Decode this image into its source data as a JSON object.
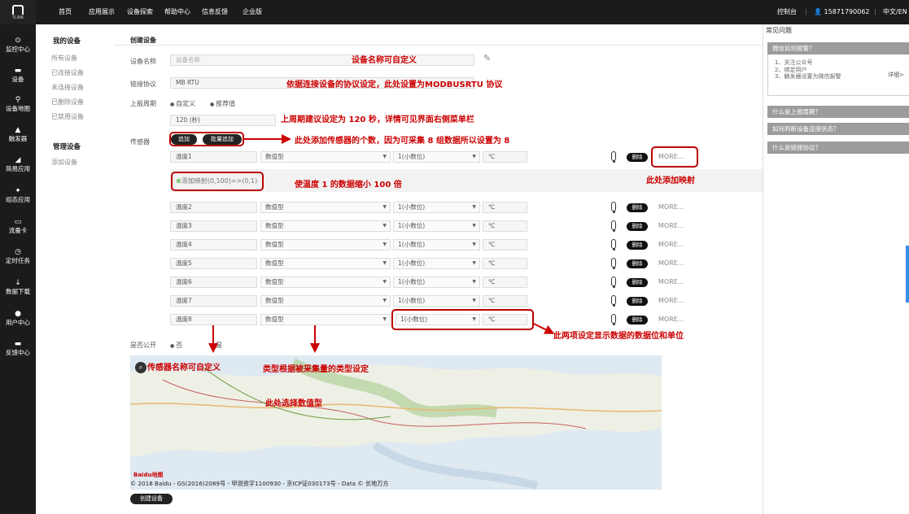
{
  "topbar": {
    "logo_caption": "TLINK",
    "nav": [
      "首页",
      "应用展示",
      "设备探索",
      "帮助中心",
      "信息反馈",
      "企业版"
    ],
    "console": "控制台",
    "user": "15871790062",
    "lang": "中文/EN"
  },
  "sidebar": {
    "items": [
      "监控中心",
      "设备",
      "设备地图",
      "触发器",
      "简易应用",
      "组态应用",
      "流量卡",
      "定时任务",
      "数据下载",
      "用户中心",
      "反馈中心"
    ]
  },
  "submenu": {
    "my_devices": "我的设备",
    "items": [
      "所有设备",
      "已连接设备",
      "未连接设备",
      "已删除设备",
      "已禁用设备"
    ],
    "manage": "管理设备",
    "add_device": "添加设备"
  },
  "form": {
    "title": "创建设备",
    "name_label": "设备名称",
    "name_placeholder": "设备名称",
    "protocol_label": "链接协议",
    "protocol_value": "MB RTU",
    "period_label": "上报周期",
    "period_opt1": "自定义",
    "period_opt2": "推荐值",
    "period_value": "120 (秒)",
    "sensor_label": "传感器",
    "add_btn": "追加",
    "batch_add_btn": "批量追加",
    "mapping_link": "添加映射(0,100)=>(0,1)",
    "delete_label": "删除",
    "more_label": "MORE...",
    "public_label": "是否公开",
    "public_no": "否",
    "public_yes": "是",
    "create_btn": "创建设备"
  },
  "sensors": [
    {
      "name": "温度1",
      "type": "数值型",
      "decimals": "1(小数位)",
      "unit": "℃"
    },
    {
      "name": "温度2",
      "type": "数值型",
      "decimals": "1(小数位)",
      "unit": "℃"
    },
    {
      "name": "温度3",
      "type": "数值型",
      "decimals": "1(小数位)",
      "unit": "℃"
    },
    {
      "name": "温度4",
      "type": "数值型",
      "decimals": "1(小数位)",
      "unit": "℃"
    },
    {
      "name": "温度5",
      "type": "数值型",
      "decimals": "1(小数位)",
      "unit": "℃"
    },
    {
      "name": "温度6",
      "type": "数值型",
      "decimals": "1(小数位)",
      "unit": "℃"
    },
    {
      "name": "温度7",
      "type": "数值型",
      "decimals": "1(小数位)",
      "unit": "℃"
    },
    {
      "name": "温度8",
      "type": "数值型",
      "decimals": "1(小数位)",
      "unit": "℃"
    }
  ],
  "annotations": {
    "name": "设备名称可自定义",
    "protocol": "依据连接设备的协议设定，此处设置为MODBUSRTU 协议",
    "period": "上周期建议设定为 120 秒，详情可见界面右侧菜单栏",
    "sensor_count": "此处添加传感器的个数，因为可采集 8 组数据所以设置为 8",
    "mapping": "使温度 1 的数据缩小 100 倍",
    "add_mapping": "此处添加映射",
    "decimals_unit": "此两项设定显示数据的数据位和单位",
    "sensor_name": "传感器名称可自定义",
    "type": "类型根据被采集量的类型设定",
    "numeric": "此处选择数值型"
  },
  "map": {
    "logo": "Baidu地图",
    "copyright": "© 2018 Baidu - GS(2016)2089号 - 甲测资字1100930 - 京ICP证030173号 - Data © 长地万方"
  },
  "faq": {
    "title": "常见问题",
    "q1": "微信如何报警？",
    "q1_steps": [
      "1、关注公众号",
      "2、绑定用户",
      "3、触发器设置为微信报警"
    ],
    "q1_detail": "详细>",
    "q2": "什么是上报周期？",
    "q3": "如何判断设备连接状态？",
    "q4": "什么是链接协议？"
  }
}
